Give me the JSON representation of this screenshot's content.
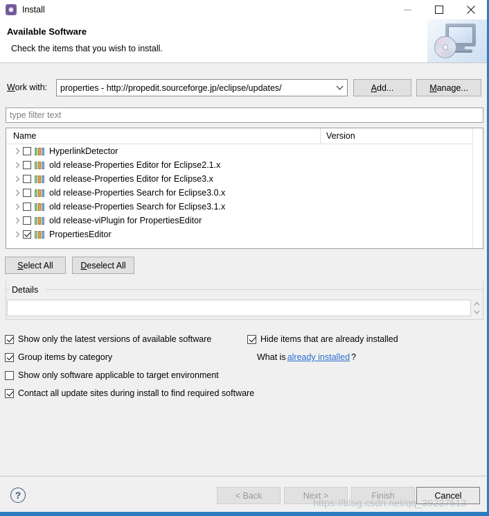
{
  "window": {
    "title": "Install",
    "icon": "install-gear-icon",
    "controls": {
      "minimize": "minimize-icon",
      "maximize": "maximize-icon",
      "close": "close-icon"
    },
    "accent_color": "#2b7cc0",
    "background_color": "#f0f0f0"
  },
  "header": {
    "title": "Available Software",
    "subtitle": "Check the items that you wish to install.",
    "banner_icon": "monitor-with-cd-icon"
  },
  "work_with": {
    "label": "Work with:",
    "label_mnemonic": "W",
    "value": "properties - http://propedit.sourceforge.jp/eclipse/updates/",
    "dropdown_icon": "chevron-down-icon",
    "add_button": "Add...",
    "manage_button": "Manage..."
  },
  "filter": {
    "placeholder": "type filter text",
    "value": ""
  },
  "tree": {
    "columns": [
      "Name",
      "Version"
    ],
    "rows": [
      {
        "name": "HyperlinkDetector",
        "version": "",
        "checked": false,
        "expandable": true
      },
      {
        "name": "old release-Properties Editor for Eclipse2.1.x",
        "version": "",
        "checked": false,
        "expandable": true
      },
      {
        "name": "old release-Properties Editor for Eclipse3.x",
        "version": "",
        "checked": false,
        "expandable": true
      },
      {
        "name": "old release-Properties Search for Eclipse3.0.x",
        "version": "",
        "checked": false,
        "expandable": true
      },
      {
        "name": "old release-Properties Search for Eclipse3.1.x",
        "version": "",
        "checked": false,
        "expandable": true
      },
      {
        "name": "old release-viPlugin for PropertiesEditor",
        "version": "",
        "checked": false,
        "expandable": true
      },
      {
        "name": "PropertiesEditor",
        "version": "",
        "checked": true,
        "expandable": true
      }
    ]
  },
  "selection_buttons": {
    "select_all": "Select All",
    "deselect_all": "Deselect All"
  },
  "details": {
    "legend": "Details",
    "value": ""
  },
  "options": [
    {
      "label": "Show only the latest versions of available software",
      "checked": true
    },
    {
      "label": "Group items by category",
      "checked": true
    },
    {
      "label": "Show only software applicable to target environment",
      "checked": false
    },
    {
      "label": "Contact all update sites during install to find required software",
      "checked": true
    },
    {
      "label": "Hide items that are already installed",
      "checked": true
    }
  ],
  "what_is": {
    "prefix": "What is",
    "link": "already installed",
    "suffix": "?"
  },
  "footer": {
    "help_icon": "help-question-icon",
    "back": "< Back",
    "next": "Next >",
    "finish": "Finish",
    "cancel": "Cancel"
  },
  "watermark": "https://blog.csdn.net/qq_39237513"
}
